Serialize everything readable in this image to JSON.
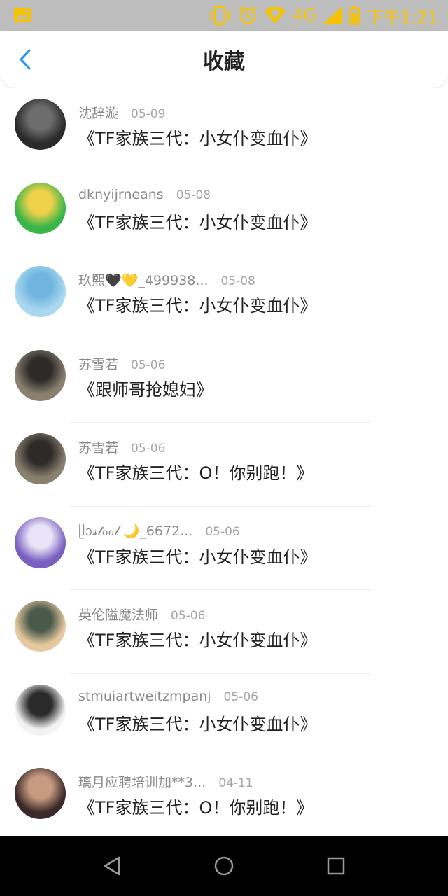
{
  "status_bar": {
    "network": "4G",
    "time": "下午1:21"
  },
  "header": {
    "title": "收藏",
    "back_icon": "chevron-left-icon"
  },
  "items": [
    {
      "name": "沈辞漩",
      "date": "05-09",
      "title": "《TF家族三代：小女仆变血仆》",
      "avatar_colors": [
        "#2a2a2a",
        "#6d6d6d"
      ]
    },
    {
      "name": "dknyijrneans",
      "date": "05-08",
      "title": "《TF家族三代：小女仆变血仆》",
      "avatar_colors": [
        "#3ab54a",
        "#f0d24a"
      ]
    },
    {
      "name": "玖熙🖤💛_499938...",
      "date": "05-08",
      "title": "《TF家族三代：小女仆变血仆》",
      "avatar_colors": [
        "#a9d8f0",
        "#6fb5de"
      ]
    },
    {
      "name": "苏雪若",
      "date": "05-06",
      "title": "《跟师哥抢媳妇》",
      "avatar_colors": [
        "#8a8070",
        "#2d2a28"
      ]
    },
    {
      "name": "苏雪若",
      "date": "05-06",
      "title": "《TF家族三代：O！你别跑！》",
      "avatar_colors": [
        "#8a8070",
        "#2d2a28"
      ]
    },
    {
      "name": "ᥫᩣ𝓈𝓉ℴℴ𝓁 🌙_6672...",
      "date": "05-06",
      "title": "《TF家族三代：小女仆变血仆》",
      "avatar_colors": [
        "#7a5fc0",
        "#e9e4f7"
      ]
    },
    {
      "name": "英伦隘魔法师",
      "date": "05-06",
      "title": "《TF家族三代：小女仆变血仆》",
      "avatar_colors": [
        "#e6c9a0",
        "#4a5a4a"
      ]
    },
    {
      "name": "stmuiartweitzmpanj",
      "date": "05-06",
      "title": "《TF家族三代：小女仆变血仆》",
      "avatar_colors": [
        "#f2f2f2",
        "#2a2a2a"
      ]
    },
    {
      "name": "璃月应聘培训加**3...",
      "date": "04-11",
      "title": "《TF家族三代：O！你别跑！》",
      "avatar_colors": [
        "#3a2a2a",
        "#c89a80"
      ]
    }
  ],
  "nav": {
    "back": "back-triangle-icon",
    "home": "home-circle-icon",
    "recent": "recent-square-icon"
  },
  "colors": {
    "accent": "#2196f3",
    "status_icon": "#f5c300"
  }
}
